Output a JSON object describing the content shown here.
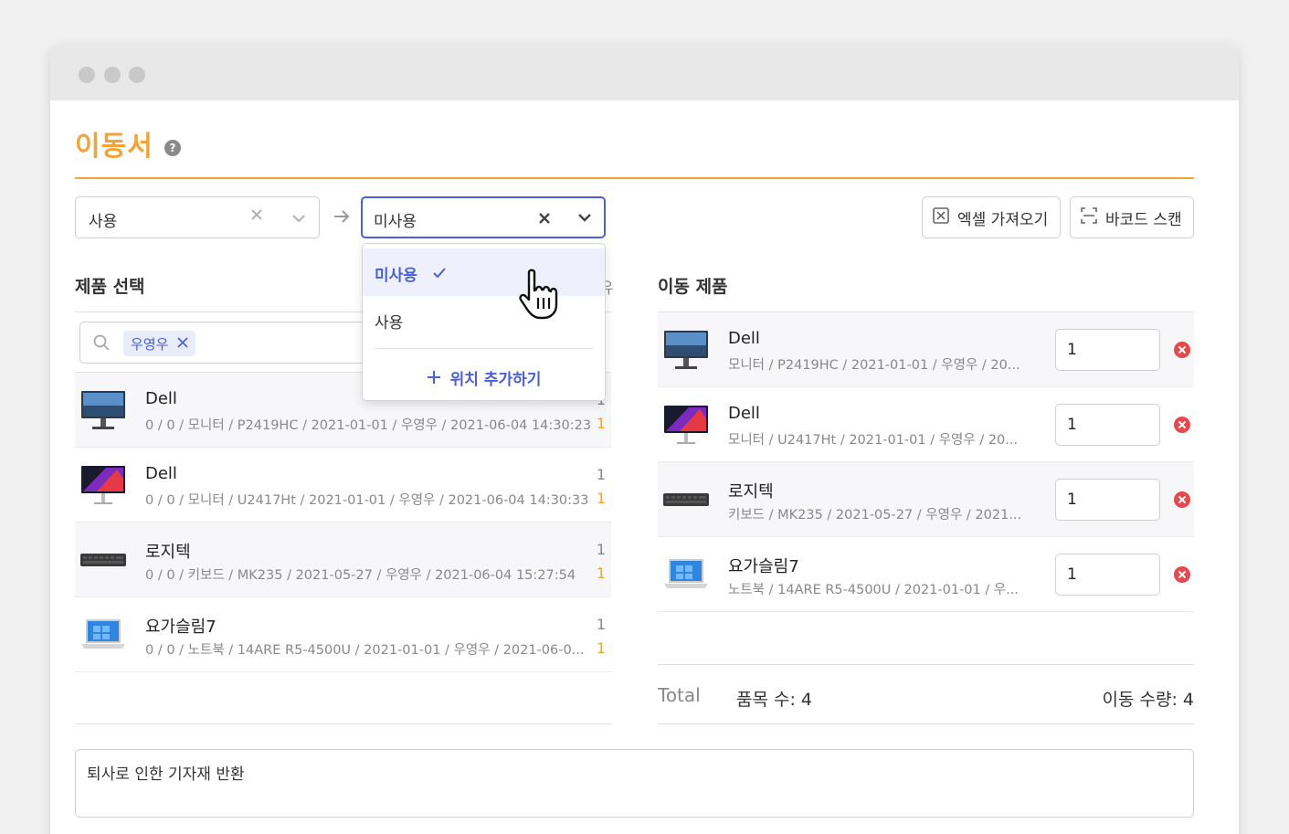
{
  "page": {
    "title": "이동서",
    "help_icon": "?"
  },
  "from_select": {
    "value": "사용"
  },
  "to_select": {
    "value": "미사용"
  },
  "dropdown": {
    "options": [
      {
        "label": "미사용",
        "selected": true
      },
      {
        "label": "사용",
        "selected": false
      }
    ],
    "add_location_label": "위치 추가하기"
  },
  "toolbar": {
    "excel_import_label": "엑셀 가져오기",
    "barcode_scan_label": "바코드 스캔"
  },
  "product_select": {
    "title": "제품 선택",
    "search_tag": "우영우",
    "column_header_partial": "유",
    "items": [
      {
        "name": "Dell",
        "meta": "0 / 0 / 모니터 / P2419HC / 2021-01-01 / 우영우 / 2021-06-04 14:30:23",
        "n1": "1",
        "n2": "1",
        "thumb": "monitor-icon"
      },
      {
        "name": "Dell",
        "meta": "0 / 0 / 모니터 / U2417Ht / 2021-01-01 / 우영우 / 2021-06-04 14:30:33",
        "n1": "1",
        "n2": "1",
        "thumb": "monitor-icon"
      },
      {
        "name": "로지텍",
        "meta": "0 / 0 / 키보드 / MK235 / 2021-05-27 / 우영우 / 2021-06-04 15:27:54",
        "n1": "1",
        "n2": "1",
        "thumb": "keyboard-icon"
      },
      {
        "name": "요가슬림7",
        "meta": "0 / 0 / 노트북 / 14ARE R5-4500U / 2021-01-01 / 우영우 / 2021-06-0...",
        "n1": "1",
        "n2": "1",
        "thumb": "laptop-icon"
      }
    ]
  },
  "moved_products": {
    "title": "이동 제품",
    "items": [
      {
        "name": "Dell",
        "meta": "모니터 / P2419HC / 2021-01-01 / 우영우 / 20...",
        "qty": "1"
      },
      {
        "name": "Dell",
        "meta": "모니터 / U2417Ht / 2021-01-01 / 우영우 / 20...",
        "qty": "1"
      },
      {
        "name": "로지텍",
        "meta": "키보드 / MK235 / 2021-05-27 / 우영우 / 2021...",
        "qty": "1"
      },
      {
        "name": "요가슬림7",
        "meta": "노트북 / 14ARE R5-4500U / 2021-01-01 / 우...",
        "qty": "1"
      }
    ]
  },
  "totals": {
    "label": "Total",
    "item_count_label": "품목 수:  4",
    "move_qty_label": "이동 수량:  4"
  },
  "memo": {
    "text": "퇴사로 인한 기자재 반환"
  },
  "colors": {
    "accent_orange": "#f2a33a",
    "primary_blue": "#4a5fd8",
    "danger_red": "#e5484d"
  }
}
